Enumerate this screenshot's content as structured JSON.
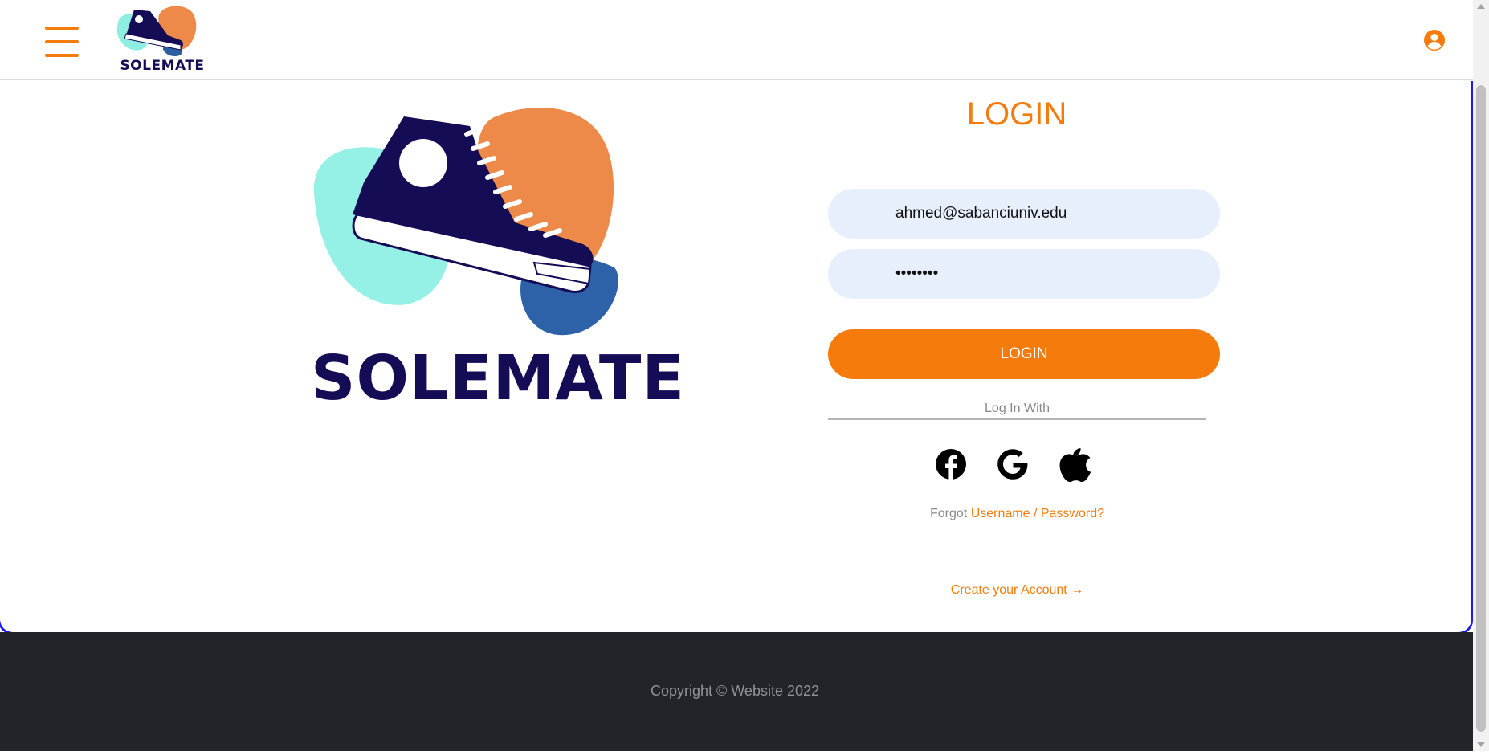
{
  "brand": {
    "name": "SOLEMATE"
  },
  "nav": {
    "menu_icon": "hamburger-menu-icon",
    "user_icon": "user-circle-icon"
  },
  "login": {
    "title": "LOGIN",
    "email_value": "ahmed@sabanciuniv.edu",
    "password_value": "password",
    "button_label": "LOGIN",
    "divider_label": "Log In With",
    "social": [
      "facebook-icon",
      "google-icon",
      "apple-icon"
    ],
    "forgot_prefix": "Forgot",
    "forgot_link": "Username / Password?",
    "create_account": "Create your Account →"
  },
  "footer": {
    "copyright": "Copyright © Website 2022"
  },
  "colors": {
    "accent": "#f47b0c",
    "brand_navy": "#140c55",
    "input_bg": "#e8effc",
    "footer_bg": "#212428"
  }
}
